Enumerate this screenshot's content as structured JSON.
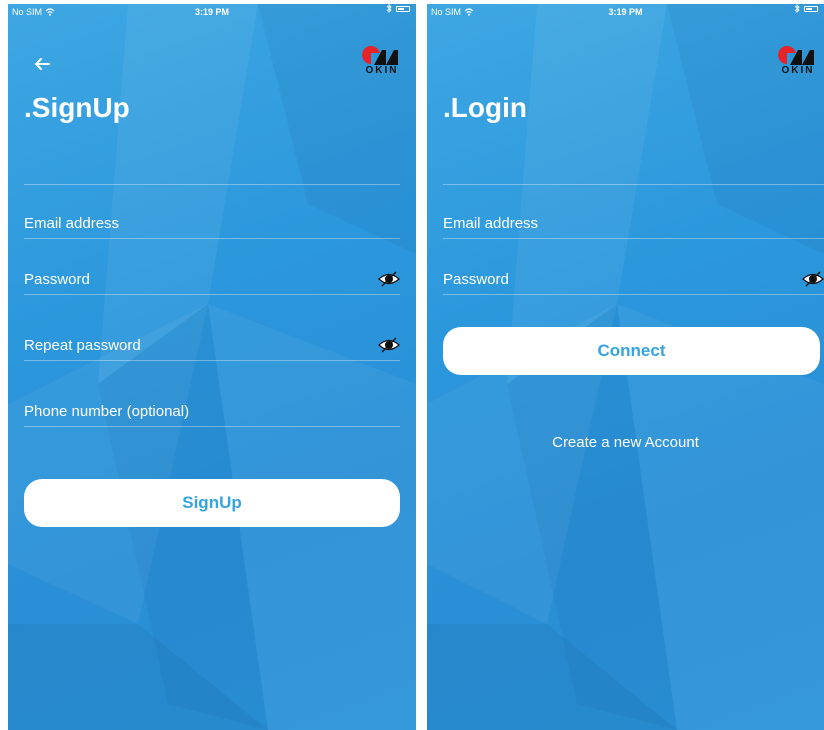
{
  "status_bar": {
    "carrier": "No SIM",
    "time": "3:19 PM"
  },
  "brand": {
    "logo_text": "OKIN",
    "logo_red": "#e52329",
    "logo_dark": "#111111"
  },
  "colors": {
    "background": "#2b97dc",
    "button_bg": "#ffffff",
    "button_text": "#35a4df"
  },
  "signup": {
    "title": ".SignUp",
    "email_placeholder": "Email address",
    "password_placeholder": "Password",
    "repeat_password_placeholder": "Repeat password",
    "phone_placeholder": "Phone number (optional)",
    "submit_label": "SignUp"
  },
  "login": {
    "title": ".Login",
    "email_placeholder": "Email address",
    "password_placeholder": "Password",
    "submit_label": "Connect",
    "create_account_label": "Create a new Account"
  }
}
